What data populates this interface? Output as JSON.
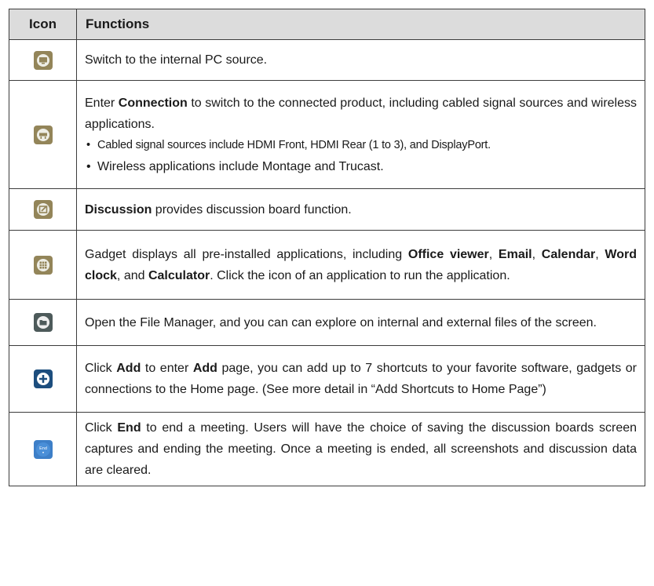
{
  "header": {
    "icon": "Icon",
    "functions": "Functions"
  },
  "rows": [
    {
      "icon": "pc-source-icon",
      "text": [
        {
          "t": "Switch to the internal PC source."
        }
      ]
    },
    {
      "icon": "connection-icon",
      "text": [
        {
          "t": "Enter "
        },
        {
          "b": "Connection"
        },
        {
          "t": " to switch to the connected product, including cabled signal sources and wireless applications."
        }
      ],
      "bullets": [
        "Cabled signal sources include HDMI Front, HDMI Rear (1 to 3), and DisplayPort.",
        "Wireless applications include Montage and Trucast."
      ]
    },
    {
      "icon": "discussion-icon",
      "text": [
        {
          "b": "Discussion"
        },
        {
          "t": " provides discussion board function."
        }
      ]
    },
    {
      "icon": "gadget-icon",
      "text": [
        {
          "t": "Gadget displays all pre-installed applications, including "
        },
        {
          "b": "Office viewer"
        },
        {
          "t": ", "
        },
        {
          "b": "Email"
        },
        {
          "t": ", "
        },
        {
          "b": "Calendar"
        },
        {
          "t": ", "
        },
        {
          "b": "Word clock"
        },
        {
          "t": ", and "
        },
        {
          "b": "Calculator"
        },
        {
          "t": ". Click the icon of an application to run the application."
        }
      ]
    },
    {
      "icon": "file-manager-icon",
      "text": [
        {
          "t": "Open the File Manager, and you can can explore on internal and external files of the screen."
        }
      ]
    },
    {
      "icon": "add-icon",
      "text": [
        {
          "t": "Click "
        },
        {
          "b": "Add"
        },
        {
          "t": " to enter "
        },
        {
          "b": "Add"
        },
        {
          "t": " page, you can add up to 7 shortcuts to your favorite software, gadgets or connections to the Home page. (See more detail in “Add Shortcuts to Home Page”)"
        }
      ]
    },
    {
      "icon": "end-icon",
      "icon_label": "End",
      "text": [
        {
          "t": "Click "
        },
        {
          "b": "End"
        },
        {
          "t": " to end a meeting. Users will have the choice of saving the discussion boards screen captures and ending the meeting. Once a meeting is ended, all screenshots and discussion data are cleared."
        }
      ]
    }
  ],
  "colors": {
    "header_bg": "#dcdcdc",
    "icon_olive": "#938559",
    "icon_slate": "#4d5a5a",
    "icon_blue": "#1d4e7e",
    "icon_end_bg": "#3d7fc8",
    "border": "#3c3c3c"
  }
}
